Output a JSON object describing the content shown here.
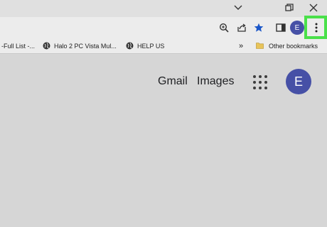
{
  "window": {
    "icons": [
      "chevron-down-icon",
      "restore-icon",
      "close-icon"
    ]
  },
  "toolbar": {
    "profile_initial": "E",
    "icons": [
      "zoom-icon",
      "share-icon",
      "bookmark-star-icon",
      "side-panel-icon",
      "more-vert-icon"
    ],
    "accent": "#1a73e8"
  },
  "bookmarks": {
    "items": [
      {
        "label": "-Full List -..."
      },
      {
        "label": "Halo 2 PC Vista Mul..."
      },
      {
        "label": "HELP US"
      }
    ],
    "overflow": "»",
    "other": "Other bookmarks"
  },
  "page": {
    "gmail": "Gmail",
    "images": "Images",
    "avatar_initial": "E",
    "avatar_color": "#4650a6"
  },
  "highlight_color": "#4ae04a"
}
